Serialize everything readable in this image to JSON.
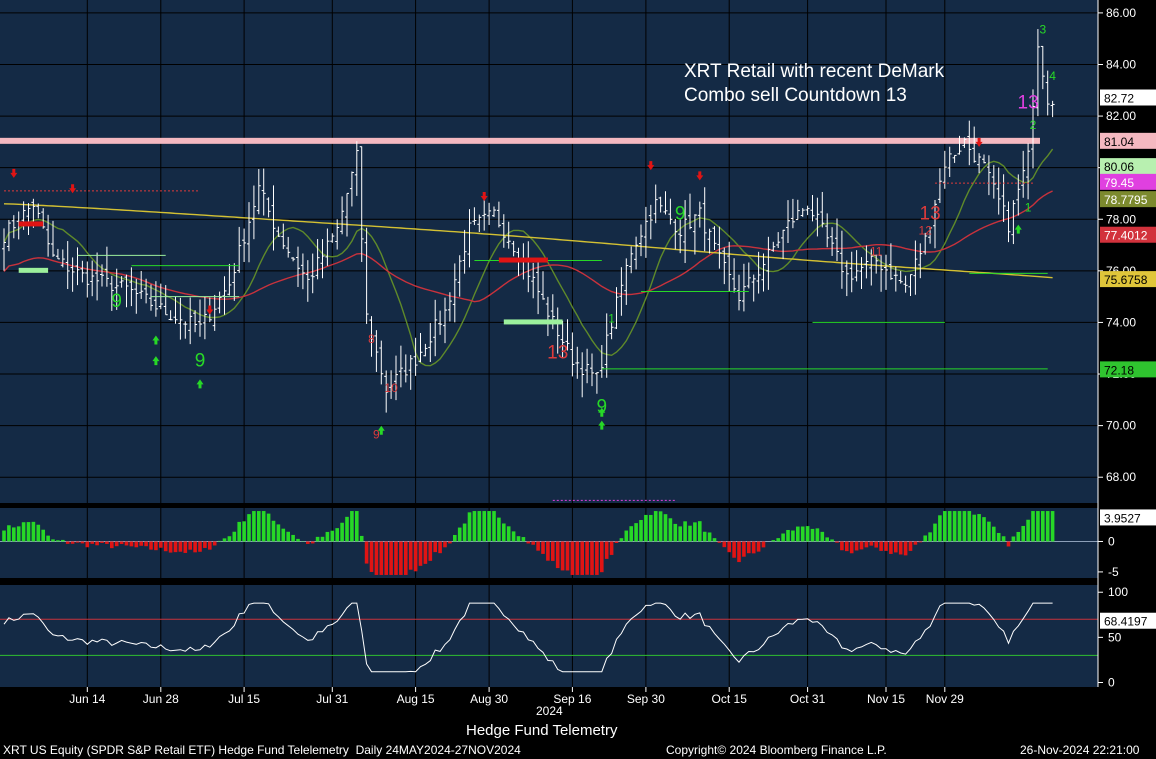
{
  "colors": {
    "panel_bg": "#142a45",
    "frame": "#000000",
    "grid": "#000000",
    "bar": "#ffffff",
    "sma_long": "#d4c133",
    "sma_mid": "#c8323c",
    "sma_short": "#5f8a2a",
    "resistance": "#f4b8c0",
    "up": "#27d827",
    "down": "#e01414",
    "countdown_sell": "#dd3b3b",
    "magenta": "#e040e0",
    "rsi_line": "#ffffff",
    "rsi_upper": "#c8323c",
    "rsi_lower": "#2fbf2f",
    "axis_text": "#ffffff"
  },
  "annotation": {
    "line1": "XRT Retail with recent DeMark",
    "line2": "Combo sell Countdown 13"
  },
  "footer": {
    "axis_year": "2024",
    "center_title": "Hedge Fund Telemetry",
    "left": "XRT US Equity (SPDR S&P Retail ETF) Hedge Fund Telelemetry  Daily 24MAY2024-27NOV2024",
    "copyright": "Copyright© 2024 Bloomberg Finance L.P.",
    "timestamp": "26-Nov-2024 22:21:00"
  },
  "chart_data": [
    {
      "type": "candlestick",
      "panel": "price",
      "ylim": [
        67,
        86.5
      ],
      "yticks": [
        "68.00",
        "70.00",
        "72.00",
        "74.00",
        "76.00",
        "78.00",
        "80.00",
        "82.00",
        "84.00",
        "86.00"
      ],
      "x_tick_labels": [
        "Jun 14",
        "Jun 28",
        "Jul 15",
        "Jul 31",
        "Aug 15",
        "Aug 30",
        "Sep 16",
        "Sep 30",
        "Oct 15",
        "Oct 31",
        "Nov 15",
        "Nov 29"
      ],
      "x_tick_index": [
        17,
        32,
        49,
        67,
        84,
        99,
        116,
        131,
        148,
        164,
        180,
        192
      ],
      "bar_count": 188,
      "bars_ohlc_sample": [
        [
          77.6,
          78.6,
          77.2,
          78.4
        ],
        [
          78.4,
          79.5,
          77.5,
          79.0
        ],
        [
          77.5,
          78.0,
          76.4,
          76.8
        ],
        [
          75.6,
          76.4,
          75.2,
          76.0
        ],
        [
          76.0,
          76.3,
          75.4,
          75.9
        ],
        [
          75.8,
          76.4,
          75.5,
          76.2
        ],
        [
          74.3,
          75.0,
          73.7,
          74.2
        ],
        [
          73.9,
          74.4,
          73.4,
          74.1
        ],
        [
          76.3,
          78.6,
          76.0,
          78.0
        ],
        [
          78.5,
          79.7,
          77.8,
          79.1
        ],
        [
          75.6,
          76.4,
          74.8,
          75.3
        ],
        [
          76.6,
          80.2,
          76.5,
          79.8
        ],
        [
          74.5,
          74.8,
          72.8,
          73.3
        ],
        [
          72.2,
          72.8,
          70.6,
          71.3
        ],
        [
          72.8,
          74.5,
          72.6,
          74.0
        ],
        [
          76.1,
          77.6,
          76.0,
          77.2
        ],
        [
          77.9,
          78.5,
          77.4,
          78.2
        ],
        [
          76.0,
          76.5,
          74.5,
          74.8
        ],
        [
          72.5,
          72.9,
          71.3,
          72.0
        ],
        [
          72.0,
          72.8,
          71.2,
          71.6
        ],
        [
          74.5,
          76.8,
          74.0,
          76.5
        ],
        [
          77.4,
          78.4,
          77.0,
          77.8
        ],
        [
          77.0,
          78.5,
          76.7,
          78.0
        ],
        [
          76.2,
          77.0,
          75.9,
          76.5
        ],
        [
          74.7,
          75.4,
          74.5,
          75.1
        ],
        [
          78.0,
          79.2,
          77.6,
          78.6
        ],
        [
          76.0,
          76.8,
          75.5,
          76.4
        ],
        [
          76.0,
          77.2,
          75.3,
          76.4
        ],
        [
          79.5,
          80.6,
          79.2,
          80.3
        ],
        [
          78.4,
          80.2,
          78.0,
          79.5
        ],
        [
          77.4,
          78.6,
          77.0,
          78.2
        ],
        [
          78.6,
          81.0,
          78.4,
          80.0
        ],
        [
          84.9,
          84.9,
          80.3,
          82.3
        ],
        [
          82.4,
          83.1,
          82.2,
          82.7
        ]
      ],
      "series": [
        {
          "name": "",
          "kind": "sma_long",
          "start": 78.6,
          "end": 75.68
        },
        {
          "name": "",
          "kind": "sma_mid",
          "start": 74.6,
          "end": 77.4
        },
        {
          "name": "",
          "kind": "sma_short",
          "start": 75.0,
          "end": 78.78
        }
      ],
      "price_labels": [
        {
          "label": "82.72",
          "value": 82.72,
          "bg": "#ffffff",
          "fg": "#000000"
        },
        {
          "label": "81.04",
          "value": 81.04,
          "bg": "#f4b8c0",
          "fg": "#000000"
        },
        {
          "label": "80.06",
          "value": 80.06,
          "bg": "#b8f0b0",
          "fg": "#000000"
        },
        {
          "label": "79.45",
          "value": 79.45,
          "bg": "#e040e0",
          "fg": "#ffffff"
        },
        {
          "label": "78.7795",
          "value": 78.78,
          "bg": "#7c8a2e",
          "fg": "#ffffff"
        },
        {
          "label": "77.4012",
          "value": 77.4,
          "bg": "#d2323c",
          "fg": "#ffffff"
        },
        {
          "label": "75.6758",
          "value": 75.68,
          "bg": "#e0c63a",
          "fg": "#000000"
        },
        {
          "label": "72.18",
          "value": 72.18,
          "bg": "#2fc42f",
          "fg": "#000000"
        }
      ],
      "resistance_level": 81.04,
      "demark_labels": [
        {
          "t": "9",
          "i": 23,
          "v": 74.6,
          "c": "up",
          "big": true
        },
        {
          "t": "9",
          "i": 40,
          "v": 72.3,
          "c": "up",
          "big": true
        },
        {
          "t": "13",
          "i": 113,
          "v": 72.6,
          "c": "down",
          "big": true
        },
        {
          "t": "9",
          "i": 122,
          "v": 70.5,
          "c": "up",
          "big": true
        },
        {
          "t": "9",
          "i": 138,
          "v": 78.0,
          "c": "up",
          "big": true
        },
        {
          "t": "13",
          "i": 189,
          "v": 78.0,
          "c": "down",
          "big": true
        },
        {
          "t": "13",
          "i": 209,
          "v": 82.3,
          "c": "magenta",
          "big": true
        },
        {
          "t": "9",
          "i": 76,
          "v": 69.5,
          "c": "down",
          "big": false
        },
        {
          "t": "10",
          "i": 79,
          "v": 71.3,
          "c": "down",
          "big": false
        },
        {
          "t": "8",
          "i": 75,
          "v": 73.2,
          "c": "down",
          "big": false
        },
        {
          "t": "1",
          "i": 124,
          "v": 74.0,
          "c": "up",
          "big": false
        },
        {
          "t": "2",
          "i": 210,
          "v": 81.5,
          "c": "up",
          "big": false
        },
        {
          "t": "3",
          "i": 212,
          "v": 85.2,
          "c": "up",
          "big": false
        },
        {
          "t": "4",
          "i": 214,
          "v": 83.4,
          "c": "up",
          "big": false
        },
        {
          "t": "1",
          "i": 209,
          "v": 78.3,
          "c": "up",
          "big": false
        },
        {
          "t": "11",
          "i": 178,
          "v": 76.6,
          "c": "down",
          "big": false
        },
        {
          "t": "12",
          "i": 188,
          "v": 77.4,
          "c": "down",
          "big": false
        }
      ]
    },
    {
      "type": "bar",
      "panel": "momentum_histogram",
      "ylim": [
        -6,
        5.5
      ],
      "yticks": [
        "0",
        "-5"
      ],
      "last_value_label": "3.9527",
      "last_value": 3.95
    },
    {
      "type": "line",
      "panel": "rsi",
      "ylim": [
        -5,
        108
      ],
      "yticks": [
        "100",
        "50",
        "0"
      ],
      "upper_band": 70,
      "lower_band": 30,
      "last_value_label": "68.4197",
      "last_value": 68.42
    }
  ]
}
